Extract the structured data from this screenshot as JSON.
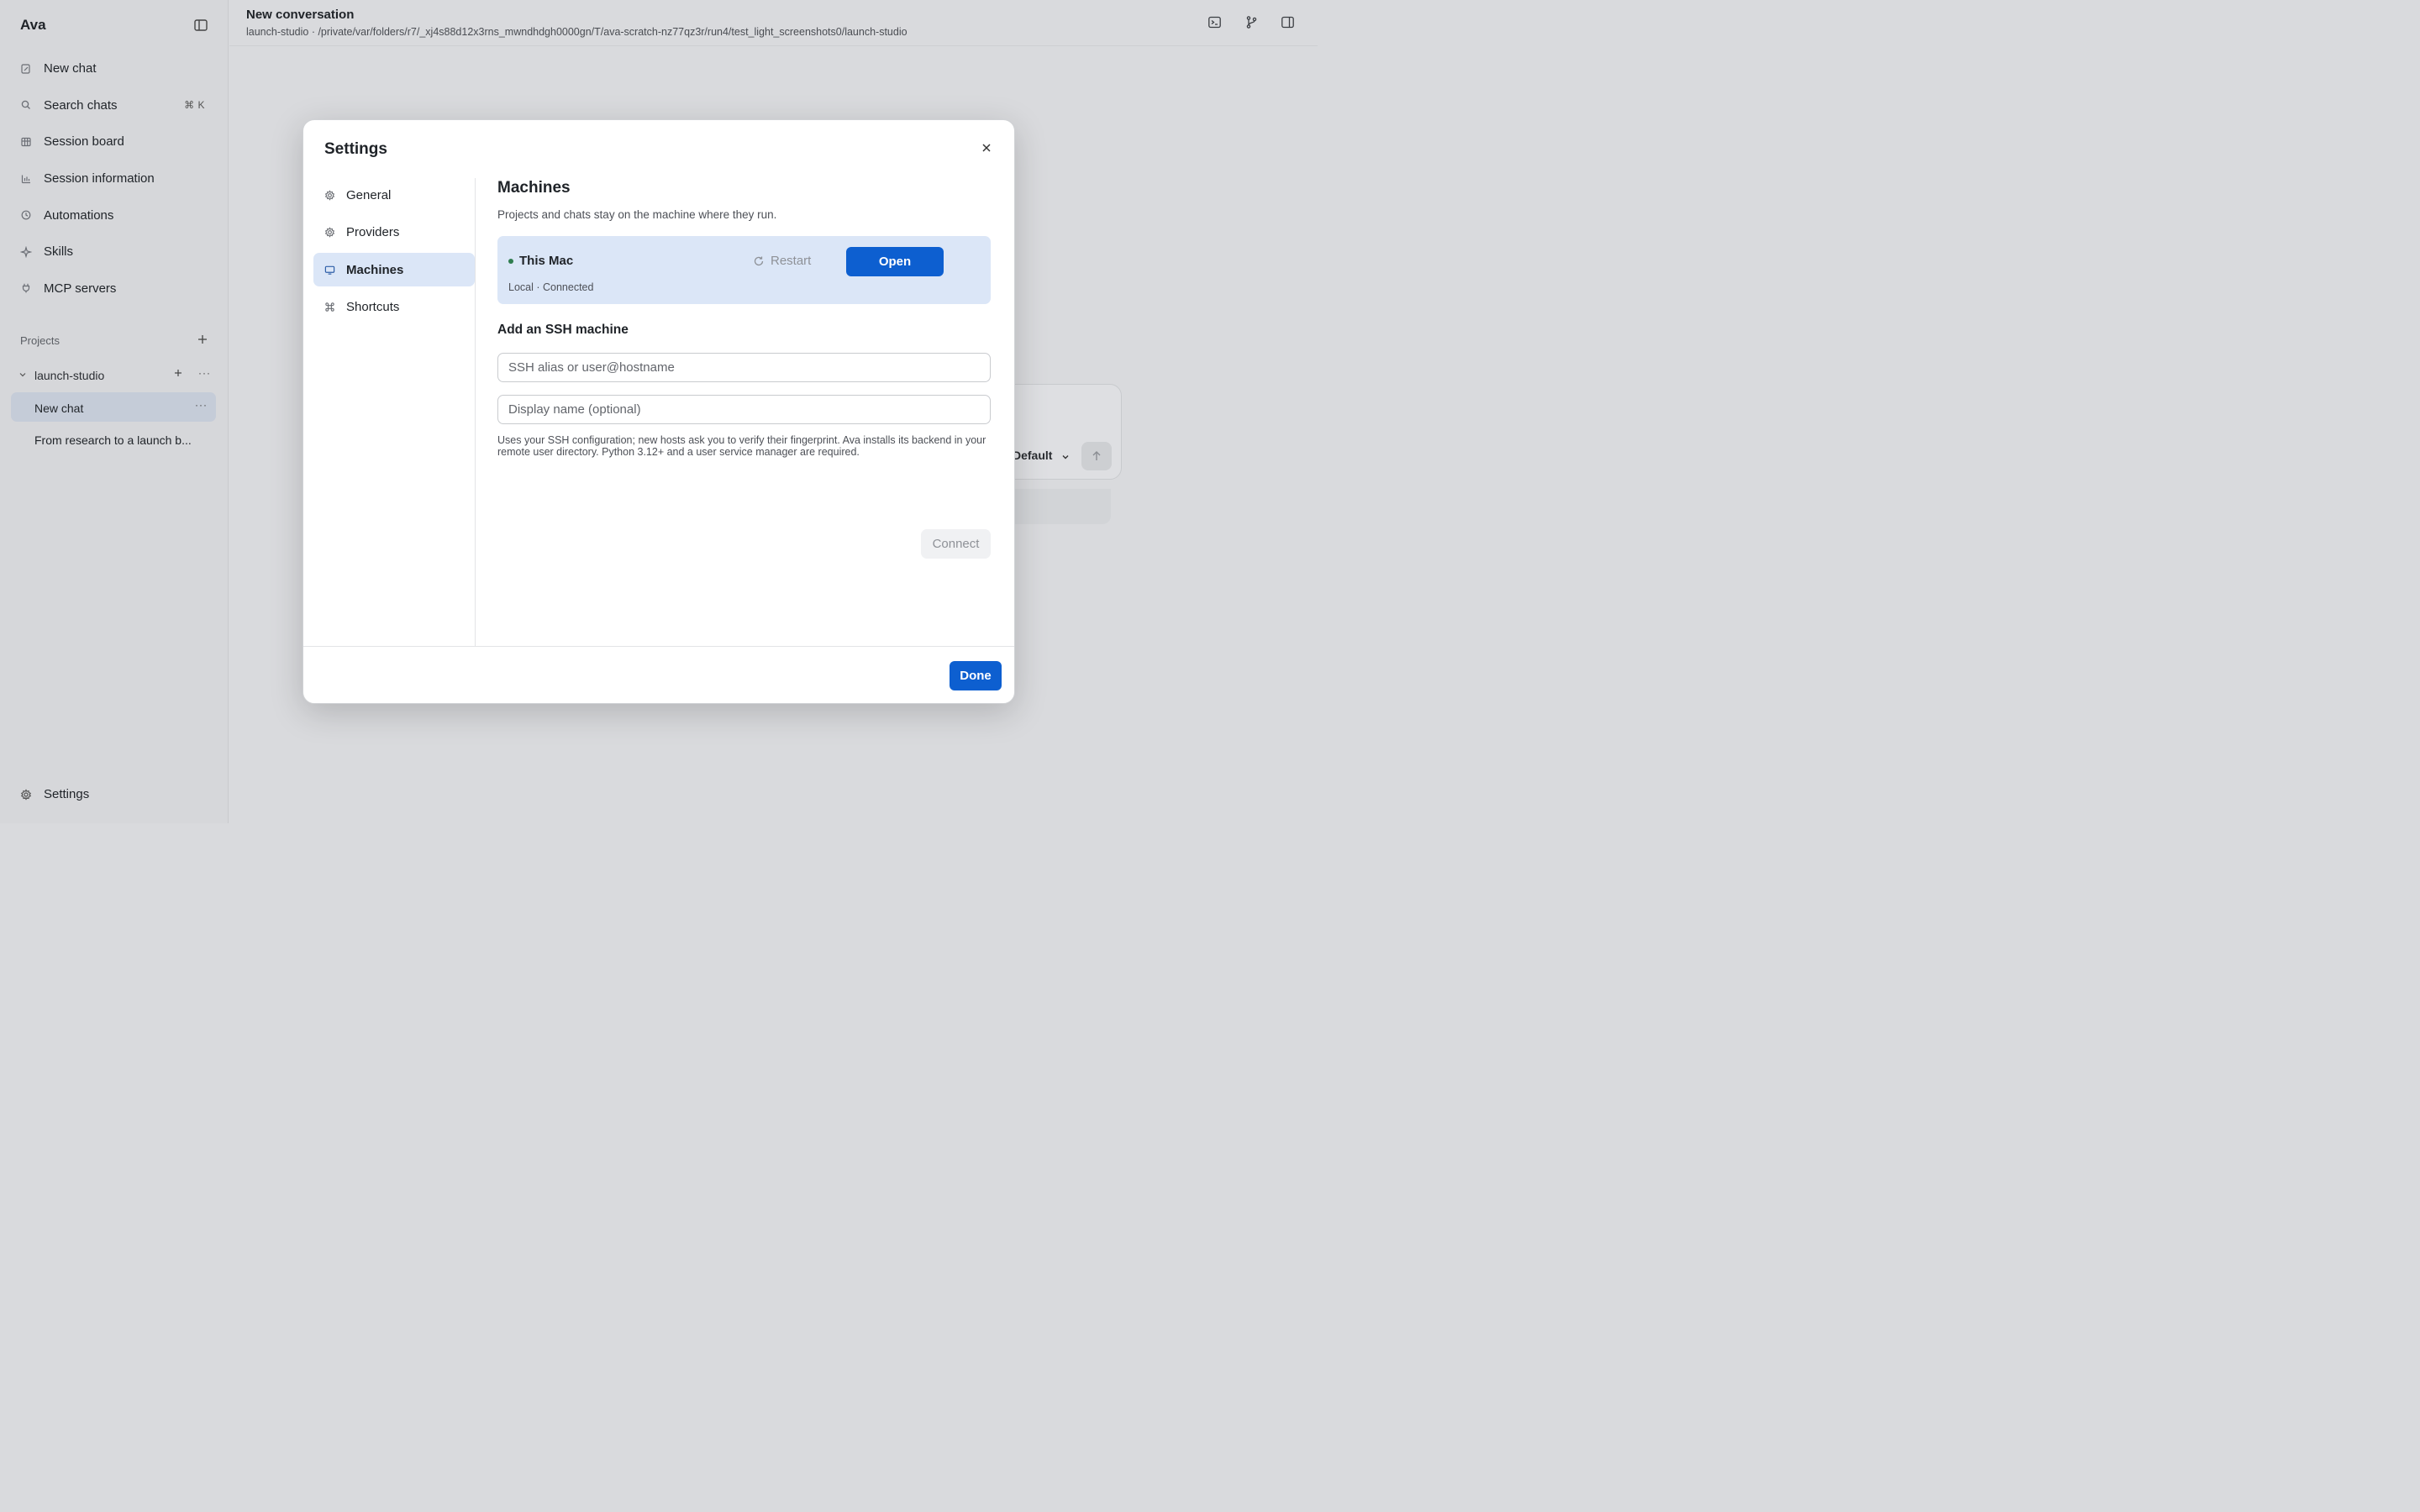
{
  "app": {
    "title": "Ava",
    "toggle_icon": "sidebar-toggle-icon"
  },
  "sidebar": {
    "nav": [
      {
        "label": "New chat",
        "icon": "edit-icon"
      },
      {
        "label": "Search chats",
        "icon": "search-icon",
        "shortcut": "⌘ K"
      },
      {
        "label": "Session board",
        "icon": "board-icon"
      },
      {
        "label": "Session information",
        "icon": "bar-chart-icon"
      },
      {
        "label": "Automations",
        "icon": "clock-icon"
      },
      {
        "label": "Skills",
        "icon": "sparkle-icon"
      },
      {
        "label": "MCP servers",
        "icon": "plug-icon"
      }
    ],
    "projects_label": "Projects",
    "project": {
      "name": "launch-studio",
      "chats": [
        {
          "title": "New chat",
          "active": true
        },
        {
          "title": "From research to a launch b..."
        }
      ]
    },
    "settings_label": "Settings"
  },
  "header": {
    "title": "New conversation",
    "path": "launch-studio · /private/var/folders/r7/_xj4s88d12x3rns_mwndhdgh0000gn/T/ava-scratch-nz77qz3r/run4/test_light_screenshots0/launch-studio",
    "icons": [
      "terminal-icon",
      "git-branch-icon",
      "panel-right-icon"
    ]
  },
  "composer": {
    "model_label": "Default"
  },
  "settings_modal": {
    "title": "Settings",
    "nav": [
      {
        "label": "General",
        "icon": "gear-icon"
      },
      {
        "label": "Providers",
        "icon": "gear-icon"
      },
      {
        "label": "Machines",
        "icon": "monitor-icon",
        "active": true
      },
      {
        "label": "Shortcuts",
        "icon": "command-icon"
      }
    ],
    "machines": {
      "title": "Machines",
      "description": "Projects and chats stay on the machine where they run.",
      "current": {
        "name": "This Mac",
        "status": "Local · Connected",
        "restart_label": "Restart",
        "open_label": "Open"
      },
      "ssh": {
        "title": "Add an SSH machine",
        "alias_placeholder": "SSH alias or user@hostname",
        "alias_value": "",
        "display_placeholder": "Display name (optional)",
        "display_value": "",
        "hint": "Uses your SSH configuration; new hosts ask you to verify their fingerprint. Ava installs its backend in your remote user directory. Python 3.12+ and a user service manager are required.",
        "connect_label": "Connect"
      }
    },
    "done_label": "Done"
  },
  "colors": {
    "accent": "#0d5fd0",
    "active_bg": "#dbe6f7",
    "status_dot": "#2f7d4f"
  }
}
